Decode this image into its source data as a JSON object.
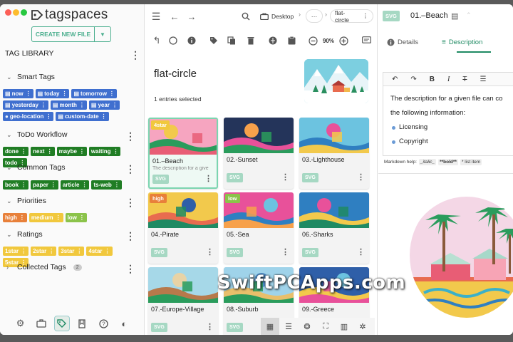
{
  "app": {
    "name": "tagspaces"
  },
  "left": {
    "create_label": "CREATE NEW FILE",
    "library_title": "TAG LIBRARY",
    "groups": [
      {
        "title": "Smart Tags",
        "expanded": true
      },
      {
        "title": "ToDo Workflow",
        "expanded": true
      },
      {
        "title": "Common Tags",
        "expanded": true
      },
      {
        "title": "Priorities",
        "expanded": true
      },
      {
        "title": "Ratings",
        "expanded": true
      },
      {
        "title": "Collected Tags",
        "expanded": false,
        "count": "2"
      }
    ],
    "smart_tags": [
      "now",
      "today",
      "tomorrow",
      "yesterday",
      "month",
      "year",
      "geo-location",
      "custom-date"
    ],
    "todo_tags": [
      "done",
      "next",
      "maybe",
      "waiting",
      "todo"
    ],
    "common_tags": [
      "book",
      "paper",
      "article",
      "ts-web"
    ],
    "priority_tags": [
      "high",
      "medium",
      "low"
    ],
    "rating_tags": [
      "1star",
      "2star",
      "3star",
      "4star",
      "5star"
    ]
  },
  "toolbar": {
    "breadcrumbs": [
      "Desktop",
      "···",
      "flat-circle"
    ],
    "zoom": "90%"
  },
  "main": {
    "folder_title": "flat-circle",
    "selection_text": "1 entries selected",
    "files": [
      {
        "name": "01.–Beach",
        "desc": "The description for a give",
        "ext": "SVG",
        "tag": "4star",
        "tag_color": "#f1c83d"
      },
      {
        "name": "02.-Sunset",
        "ext": "SVG"
      },
      {
        "name": "03.-Lighthouse",
        "ext": "SVG"
      },
      {
        "name": "04.-Pirate",
        "ext": "SVG",
        "tag": "high",
        "tag_color": "#e8803a"
      },
      {
        "name": "05.-Sea",
        "ext": "SVG",
        "tag": "low",
        "tag_color": "#8bc34a"
      },
      {
        "name": "06.-Sharks",
        "ext": "SVG"
      },
      {
        "name": "07.-Europe-Village",
        "ext": "SVG"
      },
      {
        "name": "08.-Suburb",
        "ext": "SVG"
      },
      {
        "name": "09.-Greece",
        "ext": "SVG"
      }
    ]
  },
  "right": {
    "ext": "SVG",
    "file_name": "01.–Beach",
    "tabs": [
      "Details",
      "Description"
    ],
    "active_tab": "Description",
    "description_lines": [
      "The description for a given file can co",
      "the following information:"
    ],
    "bullets": [
      "Licensing",
      "Copyright"
    ],
    "md_help_label": "Markdown help:",
    "md_help_items": [
      "_italic_",
      "**bold**",
      "* list item"
    ]
  },
  "watermark": "SwiftPCApps.com",
  "colors": {
    "accent": "#1f8a63",
    "smart": "#3f6fcf",
    "todo": "#207d24"
  }
}
